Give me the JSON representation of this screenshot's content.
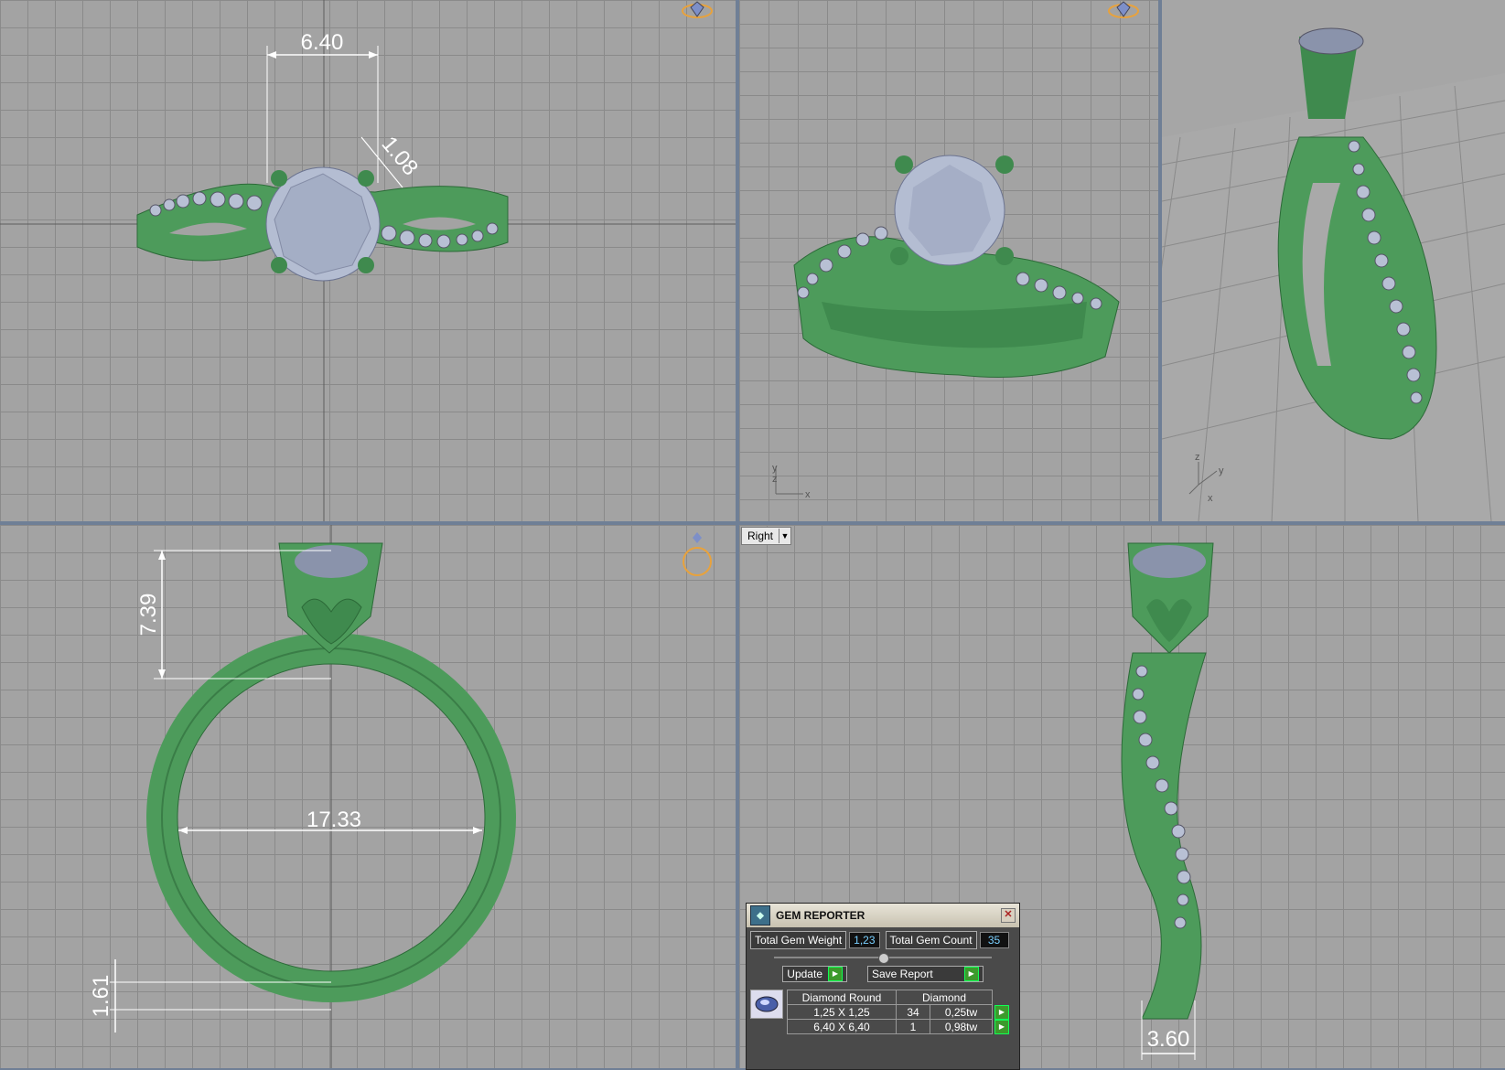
{
  "viewports": {
    "top": {
      "dims": {
        "width": "6.40",
        "prong": "1.08"
      }
    },
    "front": {
      "dims": {
        "height": "7.39",
        "inner_diameter": "17.33",
        "band": "1.61"
      }
    },
    "right": {
      "view_label": "Right",
      "dims": {
        "band_width": "3.60"
      }
    },
    "perspective": {
      "axis_x": "x",
      "axis_y": "y",
      "axis_z": "z"
    }
  },
  "gem_reporter": {
    "title": "GEM REPORTER",
    "total_weight_label": "Total Gem Weight",
    "total_weight_value": "1,23",
    "total_count_label": "Total Gem Count",
    "total_count_value": "35",
    "update_label": "Update",
    "save_report_label": "Save Report",
    "table_header": [
      "Diamond Round",
      "Diamond"
    ],
    "rows": [
      {
        "size": "1,25 X 1,25",
        "count": "34",
        "weight": "0,25tw"
      },
      {
        "size": "6,40 X 6,40",
        "count": "1",
        "weight": "0,98tw"
      }
    ]
  },
  "colors": {
    "metal": "#4f9a5c",
    "gem": "#b4bdd2",
    "dim": "#ffffff",
    "viewport_bg": "#a3a3a3",
    "accent": "#e8a23c"
  }
}
